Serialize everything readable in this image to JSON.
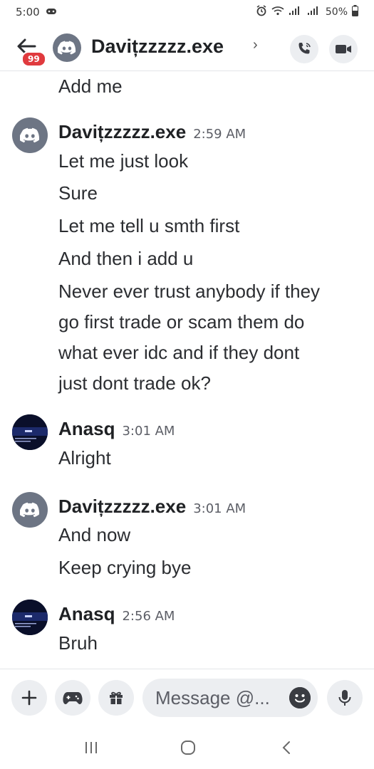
{
  "status_bar": {
    "time": "5:00",
    "battery": "50%"
  },
  "header": {
    "unread_badge": "99",
    "channel_name": "Davițzzzzz.exe",
    "chevron": "›"
  },
  "messages": {
    "leading_line": "Add me",
    "groups": [
      {
        "author": "Davițzzzzz.exe",
        "time": "2:59 AM",
        "avatar": "discord-icon",
        "lines": [
          "Let me just look",
          "Sure",
          "Let me tell u smth first",
          "And then i add u",
          "Never ever trust anybody if they",
          "go first trade or scam them do",
          "what ever idc and if they dont",
          "just dont trade ok?"
        ]
      },
      {
        "author": "Anasq",
        "time": "3:01 AM",
        "avatar": "profile-photo",
        "lines": [
          "Alright"
        ]
      },
      {
        "author": "Davițzzzzz.exe",
        "time": "3:01 AM",
        "avatar": "discord-icon",
        "lines": [
          "And now",
          "Keep crying bye"
        ]
      },
      {
        "author": "Anasq",
        "time": "2:56 AM",
        "avatar": "profile-photo",
        "lines": [
          "Bruh"
        ]
      }
    ]
  },
  "composer": {
    "placeholder": "Message @..."
  },
  "colors": {
    "avatar_gray": "#6d7584",
    "badge_red": "#e03a3e",
    "button_bg": "#eceef1"
  }
}
